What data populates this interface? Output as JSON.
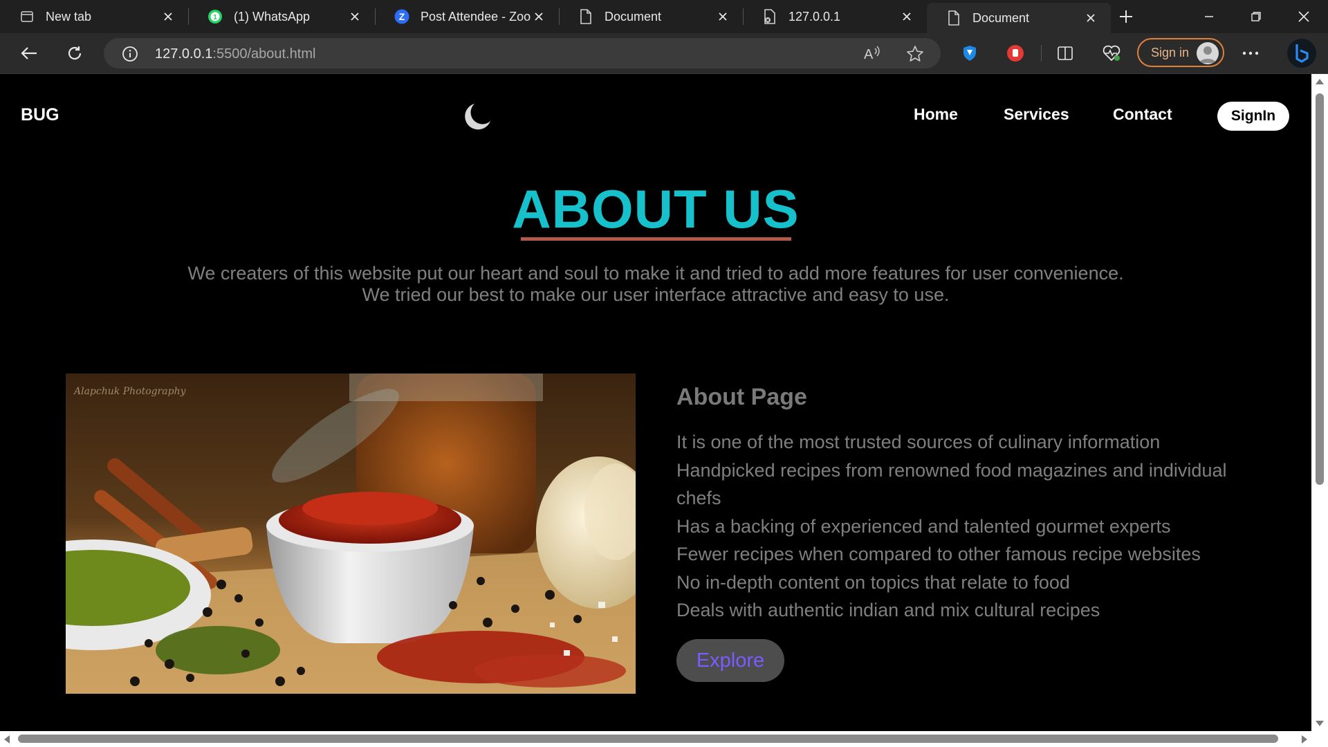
{
  "browser": {
    "tabs": [
      {
        "title": "New tab",
        "icon": "new-tab-icon"
      },
      {
        "title": "(1) WhatsApp",
        "icon": "whatsapp-icon",
        "badge": "1"
      },
      {
        "title": "Post Attendee - Zoom",
        "icon": "zoom-icon",
        "letter": "Z"
      },
      {
        "title": "Document",
        "icon": "document-icon"
      },
      {
        "title": "127.0.0.1",
        "icon": "document-icon"
      },
      {
        "title": "Document",
        "icon": "document-icon",
        "active": true
      }
    ],
    "address": {
      "host": "127.0.0.1",
      "rest": ":5500/about.html"
    },
    "signin_label": "Sign in"
  },
  "site": {
    "brand": "BUG",
    "nav": [
      "Home",
      "Services",
      "Contact"
    ],
    "signin_button": "SignIn"
  },
  "about": {
    "title": "ABOUT US",
    "intro_line1": "We creaters of this website put our heart and soul to make it and tried to add more features for user convenience.",
    "intro_line2": "We tried our best to make our user interface attractive and easy to use.",
    "heading": "About Page",
    "features": [
      "It is one of the most trusted sources of culinary information",
      "Handpicked recipes from renowned food magazines and individual chefs",
      "Has a backing of experienced and talented gourmet experts",
      "Fewer recipes when compared to other famous recipe websites",
      "No in-depth content on topics that relate to food",
      "Deals with authentic indian and mix cultural recipes"
    ],
    "explore_button": "Explore",
    "photo_watermark": "Alapchuk Photography"
  },
  "colors": {
    "accent_title": "#17c1cc",
    "underline": "#b35a4a",
    "explore_text": "#7a5cff"
  }
}
